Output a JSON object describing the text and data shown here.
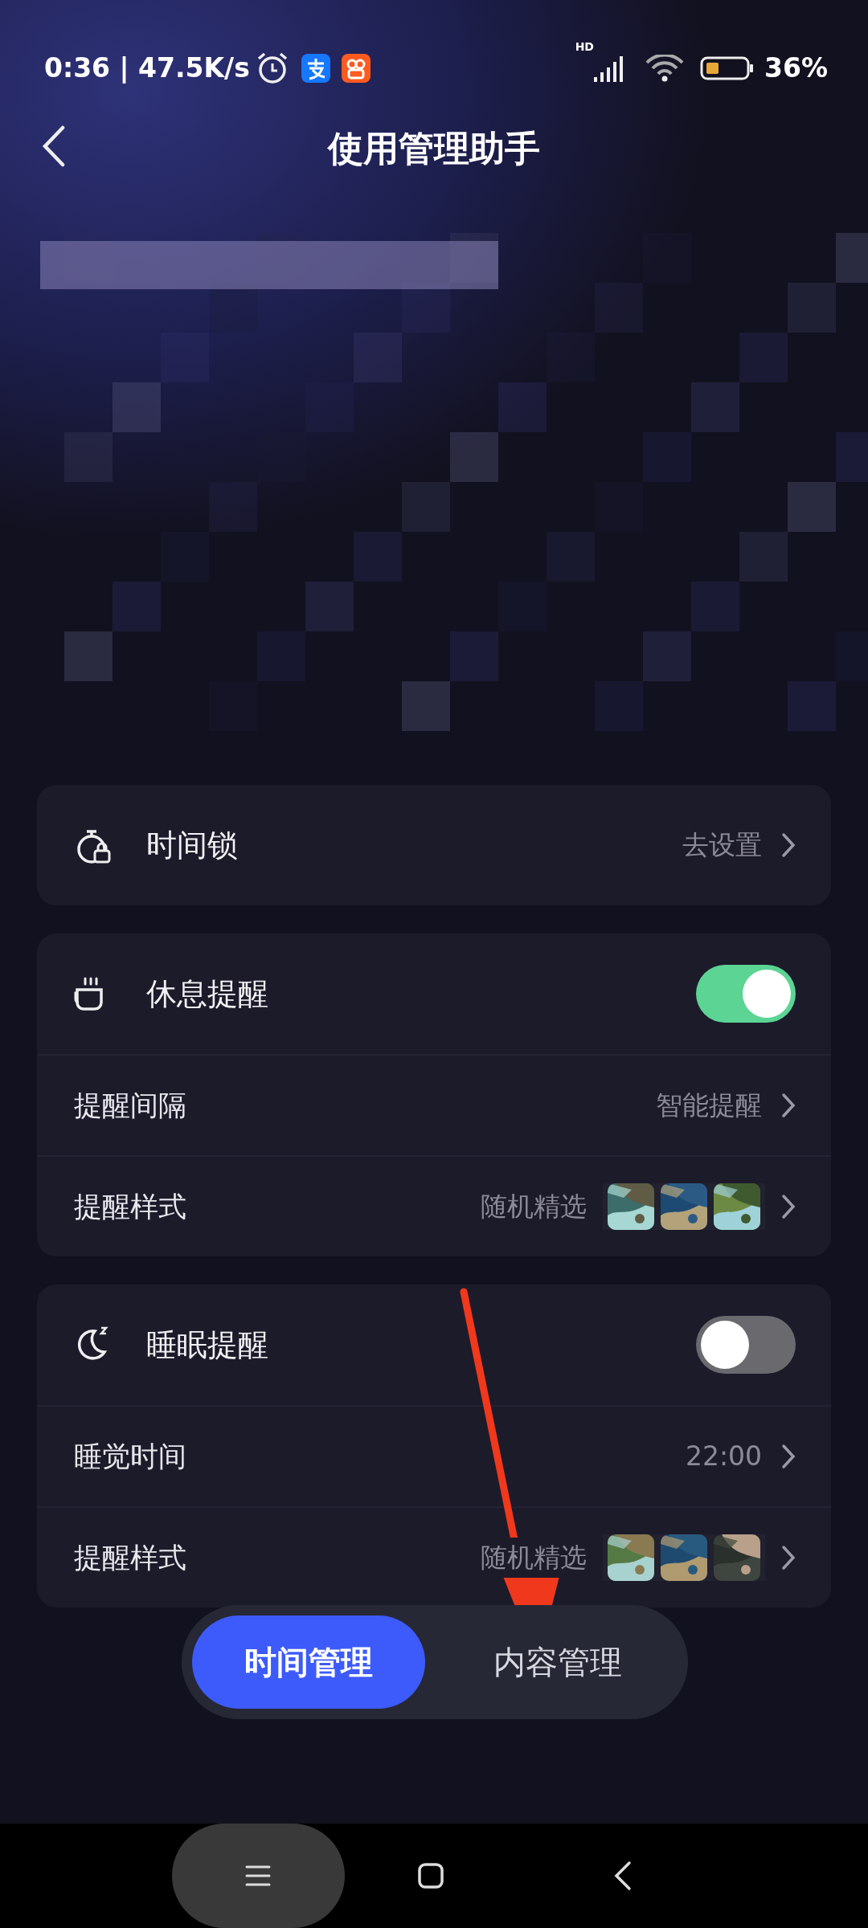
{
  "status_bar": {
    "time": "0:36 | 47.5K/s",
    "network": "HD",
    "battery": "36%"
  },
  "header": {
    "title": "使用管理助手"
  },
  "sections": [
    {
      "rows": [
        {
          "kind": "header",
          "label": "时间锁",
          "value": "去设置"
        }
      ]
    },
    {
      "rows": [
        {
          "kind": "toggle",
          "label": "休息提醒",
          "on": true
        },
        {
          "kind": "link",
          "label": "提醒间隔",
          "value": "智能提醒"
        },
        {
          "kind": "style",
          "label": "提醒样式",
          "value": "随机精选"
        }
      ]
    },
    {
      "rows": [
        {
          "kind": "toggle",
          "label": "睡眠提醒",
          "on": false
        },
        {
          "kind": "link",
          "label": "睡觉时间",
          "value": "22:00"
        },
        {
          "kind": "style",
          "label": "提醒样式",
          "value": "随机精选"
        }
      ]
    }
  ],
  "tabs": [
    {
      "label": "时间管理",
      "selected": true
    },
    {
      "label": "内容管理",
      "selected": false
    }
  ]
}
